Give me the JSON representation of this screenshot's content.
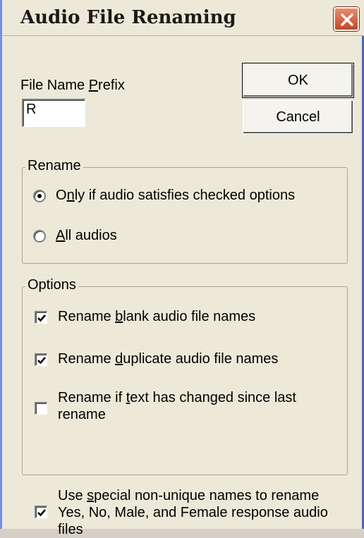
{
  "window": {
    "title": "Audio File Renaming",
    "close_icon": "close-x-icon"
  },
  "prefix": {
    "label_before": "File Name ",
    "label_hotkey": "P",
    "label_after": "refix",
    "value": "R"
  },
  "buttons": {
    "ok": "OK",
    "cancel": "Cancel"
  },
  "rename_group": {
    "legend": "Rename",
    "options": [
      {
        "before": "O",
        "hotkey": "n",
        "after": "ly if audio satisfies checked options",
        "selected": true
      },
      {
        "before": "",
        "hotkey": "A",
        "after": "ll audios",
        "selected": false
      }
    ]
  },
  "options_group": {
    "legend": "Options",
    "items": [
      {
        "before": "Rename ",
        "hotkey": "b",
        "after": "lank audio file names",
        "checked": true
      },
      {
        "before": "Rename ",
        "hotkey": "d",
        "after": "uplicate audio file names",
        "checked": true
      },
      {
        "line1_before": "Rename if ",
        "hotkey": "t",
        "line1_after": "ext has changed since last",
        "line2": "rename",
        "checked": false
      }
    ]
  },
  "special_names": {
    "line1_before": "Use ",
    "hotkey": "s",
    "line1_after": "pecial non-unique names to rename",
    "line2": "Yes, No, Male, and Female response audio",
    "line3": "files",
    "checked": true
  }
}
